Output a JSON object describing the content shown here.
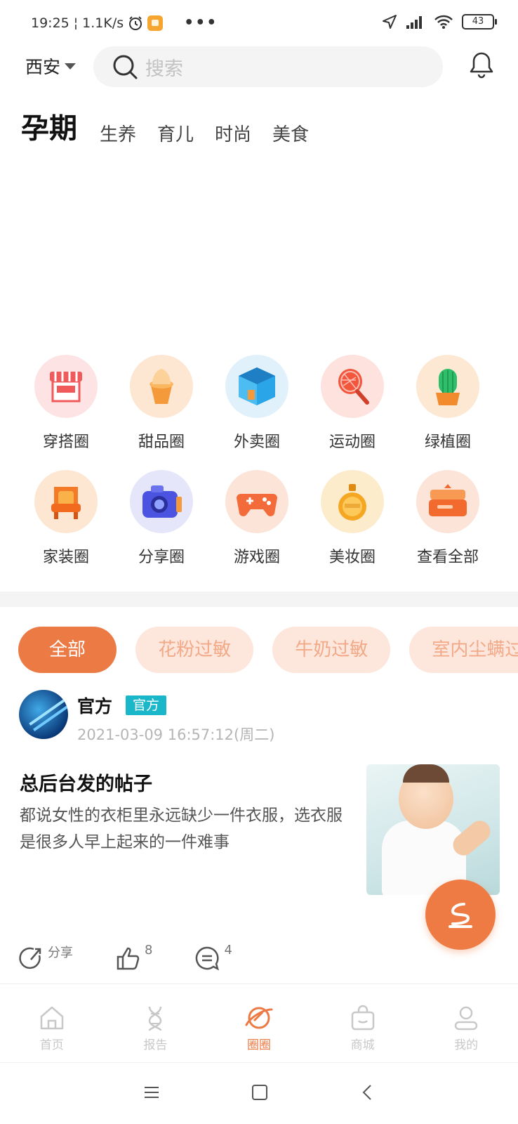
{
  "status_bar": {
    "time": "19:25",
    "network_speed": "1.1K/s",
    "battery": "43",
    "more": "•••"
  },
  "header": {
    "city": "西安",
    "search_placeholder": "搜索"
  },
  "category_tabs": [
    {
      "label": "孕期",
      "active": true
    },
    {
      "label": "生养",
      "active": false
    },
    {
      "label": "育儿",
      "active": false
    },
    {
      "label": "时尚",
      "active": false
    },
    {
      "label": "美食",
      "active": false
    }
  ],
  "circles": [
    {
      "label": "穿搭圈",
      "icon": "shop-icon",
      "color": "#f05a5a",
      "bg": "#fde3e3"
    },
    {
      "label": "甜品圈",
      "icon": "ice-cream-icon",
      "color": "#f59a3a",
      "bg": "#fde6d2"
    },
    {
      "label": "外卖圈",
      "icon": "box-icon",
      "color": "#2aa6e8",
      "bg": "#e1f1fb"
    },
    {
      "label": "运动圈",
      "icon": "racket-icon",
      "color": "#f2573e",
      "bg": "#fde2de"
    },
    {
      "label": "绿植圈",
      "icon": "cactus-icon",
      "color": "#2fbf6a",
      "bg": "#fde8d4"
    },
    {
      "label": "家装圈",
      "icon": "chair-icon",
      "color": "#f57a27",
      "bg": "#fde6d2"
    },
    {
      "label": "分享圈",
      "icon": "camera-icon",
      "color": "#4b54e0",
      "bg": "#e6e6fb"
    },
    {
      "label": "游戏圈",
      "icon": "gamepad-icon",
      "color": "#f36b3b",
      "bg": "#fde4d8"
    },
    {
      "label": "美妆圈",
      "icon": "perfume-icon",
      "color": "#f5a623",
      "bg": "#fdeccc"
    },
    {
      "label": "查看全部",
      "icon": "chest-icon",
      "color": "#f26a2e",
      "bg": "#fde4d8"
    }
  ],
  "filter_chips": [
    {
      "label": "全部",
      "active": true
    },
    {
      "label": "花粉过敏",
      "active": false
    },
    {
      "label": "牛奶过敏",
      "active": false
    },
    {
      "label": "室内尘螨过敏",
      "active": false
    }
  ],
  "post": {
    "author": "官方",
    "badge": "官方",
    "time": "2021-03-09 16:57:12(周二)",
    "title": "总后台发的帖子",
    "excerpt": "都说女性的衣柜里永远缺少一件衣服，选衣服是很多人早上起来的一件难事",
    "share_label": "分享",
    "likes": "8",
    "comments": "4"
  },
  "bottom_nav": [
    {
      "label": "首页",
      "icon": "home-icon",
      "active": false
    },
    {
      "label": "报告",
      "icon": "dna-icon",
      "active": false
    },
    {
      "label": "圈圈",
      "icon": "planet-icon",
      "active": true
    },
    {
      "label": "商城",
      "icon": "bag-icon",
      "active": false
    },
    {
      "label": "我的",
      "icon": "profile-icon",
      "active": false
    }
  ],
  "colors": {
    "accent": "#ec7a45",
    "chip_bg": "#fde6dc",
    "chip_text": "#f2a987",
    "badge": "#19b7c9"
  }
}
